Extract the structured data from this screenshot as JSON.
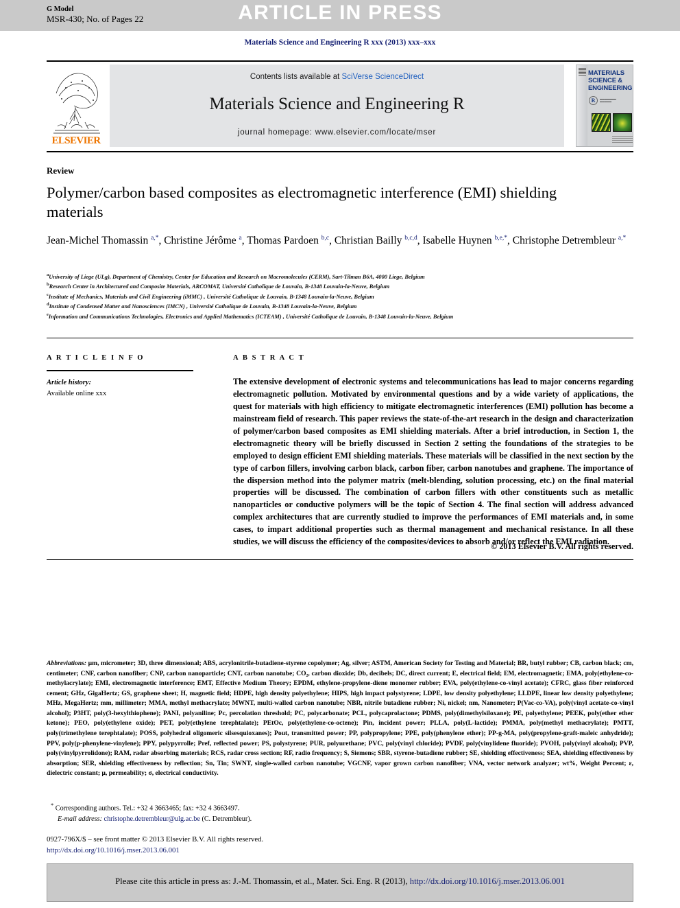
{
  "banner": {
    "g_model": "G Model",
    "model_id": "MSR-430; No. of Pages 22",
    "article_in_press": "ARTICLE IN PRESS"
  },
  "journal_ref": "Materials Science and Engineering R xxx (2013) xxx–xxx",
  "masthead": {
    "publisher": "ELSEVIER",
    "contents_prefix": "Contents lists available at ",
    "contents_link": "SciVerse ScienceDirect",
    "journal_title": "Materials Science and Engineering R",
    "homepage": "journal homepage: www.elsevier.com/locate/mser",
    "cover": {
      "title_line1": "MATERIALS",
      "title_line2": "SCIENCE &",
      "title_line3": "ENGINEERING",
      "badge": "R"
    }
  },
  "article": {
    "kicker": "Review",
    "title": "Polymer/carbon based composites as electromagnetic interference (EMI) shielding materials",
    "authors_html": "Jean-Michel Thomassin <sup>a,*</sup>, Christine Jérôme <sup>a</sup>, Thomas Pardoen <sup>b,c</sup>, Christian Bailly <sup>b,c,d</sup>, Isabelle Huynen <sup>b,e,*</sup>, Christophe Detrembleur <sup>a,*</sup>",
    "affiliations": [
      {
        "mark": "a",
        "text": "University of Liege (ULg), Department of Chemistry, Center for Education and Research on Macromolecules (CERM), Sart-Tilman B6A, 4000 Liege, Belgium"
      },
      {
        "mark": "b",
        "text": "Research Center in Architectured and Composite Materials, ARCOMAT, Université Catholique de Louvain, B-1348 Louvain-la-Neuve, Belgium"
      },
      {
        "mark": "c",
        "text": "Institute of Mechanics, Materials and Civil Engineering (iMMC) , Université Catholique de Louvain, B-1348 Louvain-la-Neuve, Belgium"
      },
      {
        "mark": "d",
        "text": "Institute of Condensed Matter and Nanosciences (IMCN) , Université Catholique de Louvain, B-1348 Louvain-la-Neuve, Belgium"
      },
      {
        "mark": "e",
        "text": "Information and Communications Technologies, Electronics and Applied Mathematics (ICTEAM) , Université Catholique de Louvain, B-1348 Louvain-la-Neuve, Belgium"
      }
    ]
  },
  "article_info": {
    "heading": "A R T I C L E  I N F O",
    "history_label": "Article history:",
    "history_value": "Available online xxx"
  },
  "abstract": {
    "heading": "A B S T R A C T",
    "body": "The extensive development of electronic systems and telecommunications has lead to major concerns regarding electromagnetic pollution. Motivated by environmental questions and by a wide variety of applications, the quest for materials with high efficiency to mitigate electromagnetic interferences (EMI) pollution has become a mainstream field of research. This paper reviews the state-of-the-art research in the design and characterization of polymer/carbon based composites as EMI shielding materials. After a brief introduction, in Section 1, the electromagnetic theory will be briefly discussed in Section 2 setting the foundations of the strategies to be employed to design efficient EMI shielding materials. These materials will be classified in the next section by the type of carbon fillers, involving carbon black, carbon fiber, carbon nanotubes and graphene. The importance of the dispersion method into the polymer matrix (melt-blending, solution processing, etc.) on the final material properties will be discussed. The combination of carbon fillers with other constituents such as metallic nanoparticles or conductive polymers will be the topic of Section 4. The final section will address advanced complex architectures that are currently studied to improve the performances of EMI materials and, in some cases, to impart additional properties such as thermal management and mechanical resistance. In all these studies, we will discuss the efficiency of the composites/devices to absorb and/or reflect the EMI radiation.",
    "copyright": "© 2013 Elsevier B.V. All rights reserved."
  },
  "abbreviations": {
    "label": "Abbreviations:",
    "text": " μm, micrometer; 3D, three dimensional; ABS, acrylonitrile-butadiene-styrene copolymer; Ag, silver; ASTM, American Society for Testing and Material; BR, butyl rubber; CB, carbon black; cm, centimeter; CNF, carbon nanofiber; CNP, carbon nanoparticle; CNT, carbon nanotube; CO₂, carbon dioxide; Db, decibels; DC, direct current; E, electrical field; EM, electromagnetic; EMA, poly(ethylene-co- methylacrylate); EMI, electromagnetic interference; EMT, Effective Medium Theory; EPDM, ethylene-propylene-diene monomer rubber; EVA, poly(ethylene-co-vinyl acetate); CFRC, glass fiber reinforced cement; GHz, GigaHertz; GS, graphene sheet; H, magnetic field; HDPE, high density polyethylene; HIPS, high impact polystyrene; LDPE, low density polyethylene; LLDPE, linear low density polyethylene; MHz, MegaHertz; mm, millimeter; MMA, methyl methacrylate; MWNT, multi-walled carbon nanotube; NBR, nitrile butadiene rubber; Ni, nickel; nm, Nanometer; P(Vac-co-VA), poly(vinyl acetate-co-vinyl alcohol); P3HT, poly(3-hexylthiophene); PANI, polyaniline; Pc, percolation threshold; PC, polycarbonate; PCL, polycaprolactone; PDMS, poly(dimethylsiloxane); PE, polyethylene; PEEK, poly(ether ether ketone); PEO, poly(ethylene oxide); PET, poly(ethylene terephtalate); PEtOc, poly(ethylene-co-octene); Pin, incident power; PLLA, poly(L-lactide); PMMA, poly(methyl methacrylate); PMTT, poly(trimethylene terephtalate); POSS, polyhedral oligomeric silsesquioxanes); Pout, transmitted power; PP, polypropylene; PPE, poly(phenylene ether); PP-g-MA, poly(propylene-graft-maleic anhydride); PPV, poly(p-phenylene-vinylene); PPY, polypyrrolle; Pref, reflected power; PS, polystyrene; PUR, polyurethane; PVC, poly(vinyl chloride); PVDF, poly(vinylidene fluoride); PVOH, poly(vinyl alcohol); PVP, poly(vinylpyrrolidone); RAM, radar absorbing materials; RCS, radar cross section; RF, radio frequency; S, Siemens; SBR, styrene-butadiene rubber; SE, shielding effectiveness; SEA, shielding effectiveness by absorption; SER, shielding effectiveness by reflection; Sn, Tin; SWNT, single-walled carbon nanotube; VGCNF, vapor grown carbon nanofiber; VNA, vector network analyzer; wt%, Weight Percent; ɛ, dielectric constant; μ, permeability; σ, electrical conductivity."
  },
  "corresponding": {
    "marker": "*",
    "line1": "Corresponding authors. Tel.: +32 4 3663465; fax: +32 4 3663497.",
    "email_label": "E-mail address:",
    "email": "christophe.detrembleur@ulg.ac.be",
    "email_suffix": " (C. Detrembleur)."
  },
  "footer": {
    "issn_line": "0927-796X/$ – see front matter © 2013 Elsevier B.V. All rights reserved.",
    "doi_link": "http://dx.doi.org/10.1016/j.mser.2013.06.001"
  },
  "cite_box": {
    "prefix": "Please cite this article in press as: J.-M. Thomassin, et al., Mater. Sci. Eng. R (2013), ",
    "doi": "http://dx.doi.org/10.1016/j.mser.2013.06.001"
  },
  "colors": {
    "banner_gray": "#c9c9c9",
    "masthead_gray": "#e3e4e6",
    "link_blue": "#141f72",
    "sciencedirect_blue": "#1f5fbf",
    "elsevier_orange": "#ee7500"
  }
}
